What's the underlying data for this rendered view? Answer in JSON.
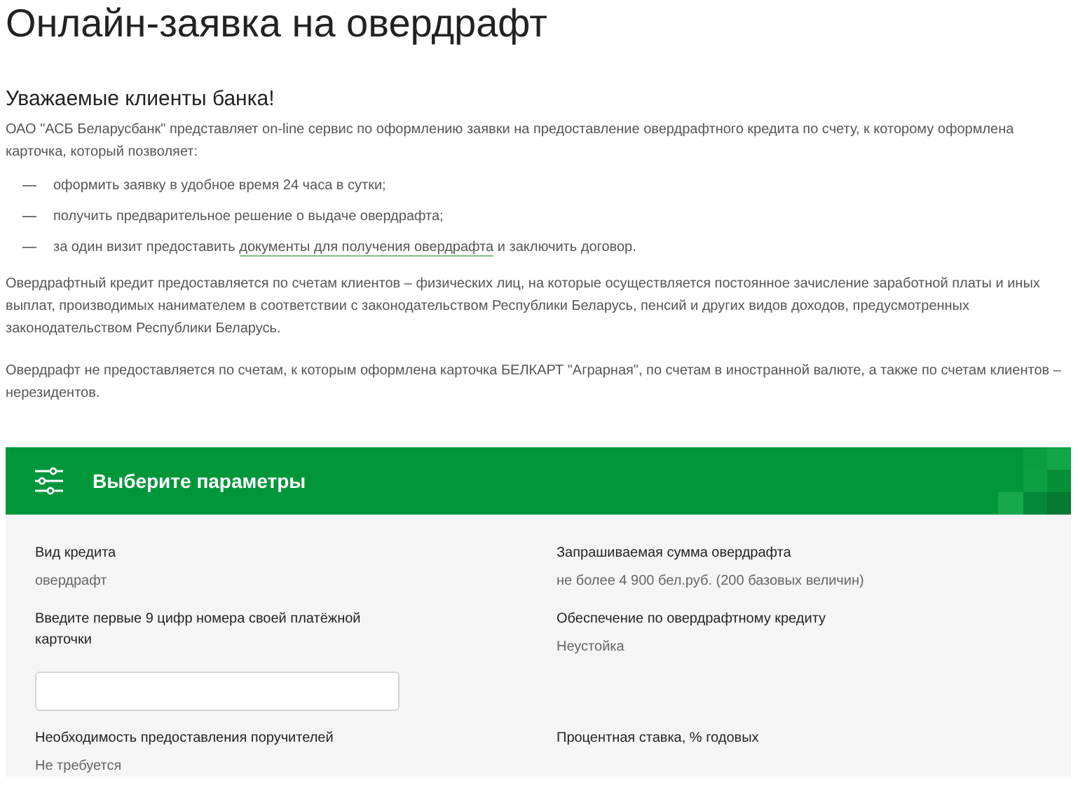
{
  "page_title": "Онлайн-заявка на овердрафт",
  "greeting": "Уважаемые клиенты банка!",
  "intro": "ОАО \"АСБ Беларусбанк\" представляет on-line сервис по оформлению заявки на предоставление овердрафтного кредита по счету, к которому оформлена карточка, который позволяет:",
  "bullets": [
    {
      "marker": "—",
      "text": "оформить заявку в удобное время 24 часа в сутки;"
    },
    {
      "marker": "—",
      "text": "получить предварительное решение о выдаче овердрафта;"
    },
    {
      "marker": "—",
      "text": "за один визит предоставить",
      "link": "документы для получения овердрафта",
      "after": "и заключить договор."
    }
  ],
  "paragraphs": [
    "Овердрафтный кредит предоставляется по счетам клиентов – физических лиц, на которые осуществляется постоянное зачисление заработной платы и иных выплат, производимых нанимателем в соответствии с законодательством Республики Беларусь, пенсий и других видов доходов, предусмотренных законодательством Республики Беларусь.",
    "Овердрафт не предоставляется по счетам, к которым оформлена карточка БЕЛКАРТ \"Аграрная\", по счетам в иностранной валюте, а также по счетам клиентов – нерезидентов."
  ],
  "panel": {
    "title": "Выберите параметры",
    "fields": [
      {
        "kind": "text",
        "label": "Вид кредита",
        "value": "овердрафт"
      },
      {
        "kind": "text",
        "label": "Запрашиваемая сумма овердрафта",
        "value": "не более 4 900 бел.руб. (200 базовых величин)"
      },
      {
        "kind": "input",
        "label": "Введите первые 9 цифр номера своей платёжной карточки"
      },
      {
        "kind": "text",
        "label": "Обеспечение по овердрафтному кредиту",
        "value": "Неустойка"
      },
      {
        "kind": "text",
        "label": "Необходимость предоставления поручителей",
        "value": "Не требуется"
      },
      {
        "kind": "text",
        "label": "Процентная ставка, % годовых"
      }
    ]
  }
}
